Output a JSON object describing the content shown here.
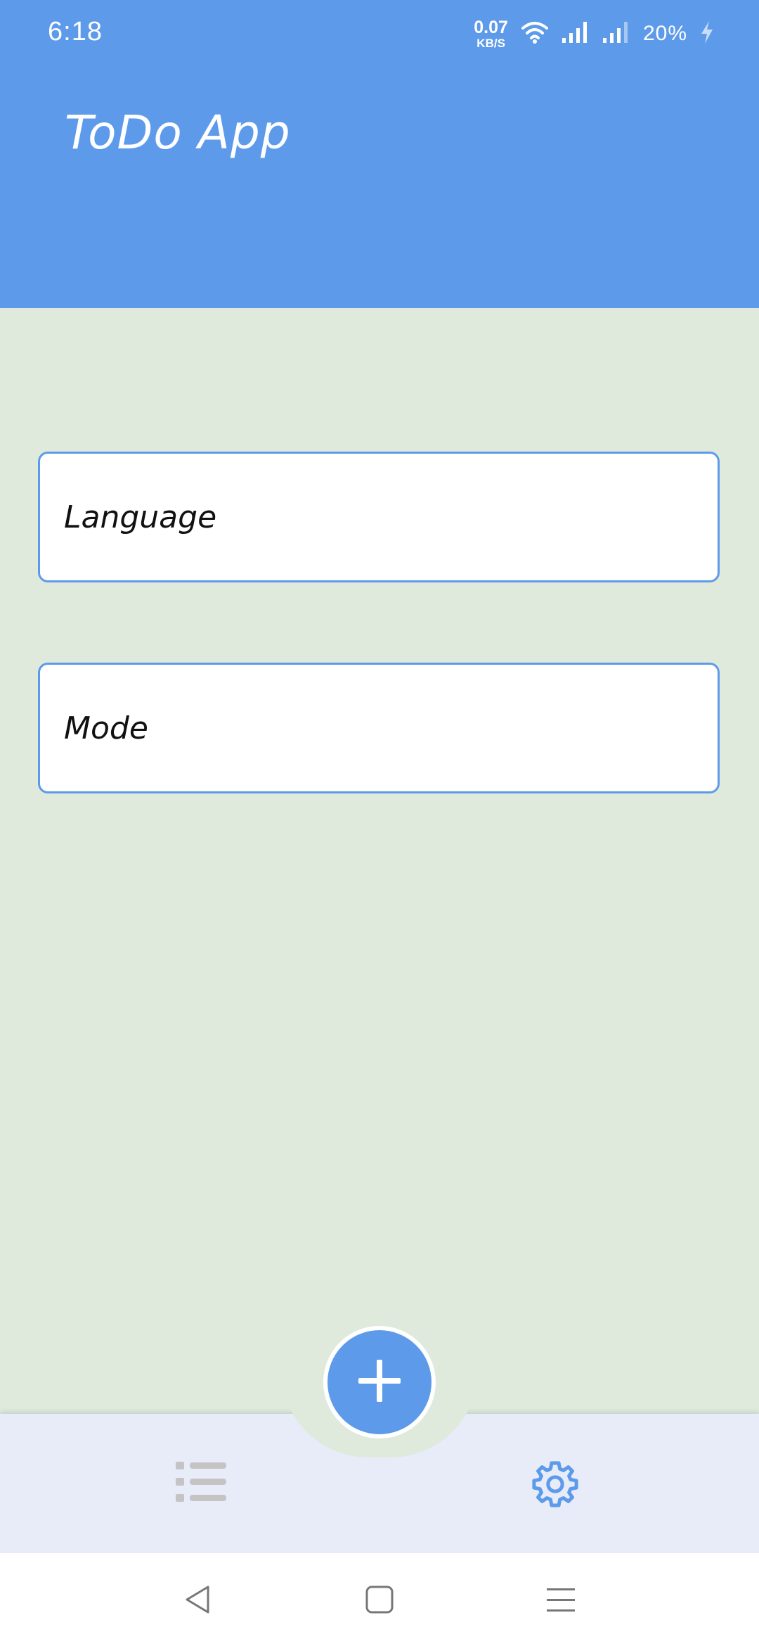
{
  "status_bar": {
    "time": "6:18",
    "net_speed_value": "0.07",
    "net_speed_unit": "KB/S",
    "battery": "20%",
    "icons": [
      "wifi-icon",
      "signal-icon",
      "signal-icon",
      "charging-icon"
    ]
  },
  "header": {
    "title": "ToDo App"
  },
  "settings": {
    "items": [
      {
        "label": "Language"
      },
      {
        "label": "Mode"
      }
    ]
  },
  "bottom_nav": {
    "add_icon": "plus-icon",
    "list_icon": "list-icon",
    "settings_icon": "gear-icon",
    "active": "settings"
  },
  "system_nav": {
    "icons": [
      "back-icon",
      "home-icon",
      "menu-icon"
    ]
  },
  "colors": {
    "primary": "#5d9bea",
    "background": "#dfeadd",
    "bottom_bar": "#e8ecf8",
    "inactive_icon": "#c4c4c4"
  }
}
